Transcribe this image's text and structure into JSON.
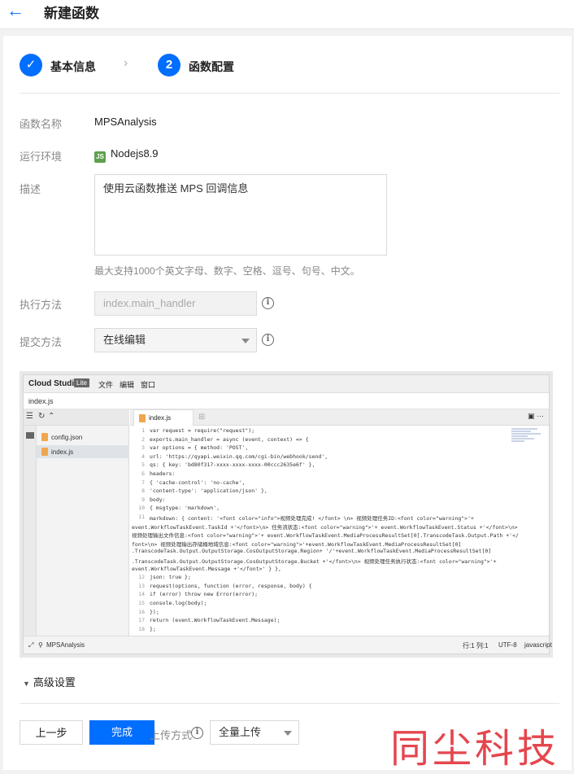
{
  "header": {
    "title": "新建函数"
  },
  "steps": [
    {
      "label": "基本信息",
      "marker": "✓"
    },
    {
      "label": "函数配置",
      "marker": "2"
    }
  ],
  "form": {
    "name_label": "函数名称",
    "name_value": "MPSAnalysis",
    "runtime_label": "运行环境",
    "runtime_value": "Nodejs8.9",
    "runtime_icon": "nodejs-icon",
    "desc_label": "描述",
    "desc_value": "使用云函数推送 MPS 回调信息",
    "desc_hint": "最大支持1000个英文字母、数字、空格、逗号、句号、中文。",
    "handler_label": "执行方法",
    "handler_value": "index.main_handler",
    "submit_label": "提交方法",
    "submit_value": "在线编辑"
  },
  "ide": {
    "brand": "Cloud Studio",
    "badge": "Lite",
    "menus": [
      "文件",
      "编辑",
      "窗口"
    ],
    "path": "index.js",
    "files": [
      "config.json",
      "index.js"
    ],
    "tab": "index.js",
    "code_lines": [
      {
        "n": "1",
        "t": "var request = require(\"request\");"
      },
      {
        "n": "2",
        "t": "exports.main_handler = async (event, context) => {"
      },
      {
        "n": "3",
        "t": "        var options = { method: 'POST',"
      },
      {
        "n": "4",
        "t": "        url: 'https://qyapi.weixin.qq.com/cgi-bin/webhook/send',"
      },
      {
        "n": "5",
        "t": "        qs: { key: 'bd80f317-xxxx-xxxx-xxxx-00ccc2635e6f' },"
      },
      {
        "n": "6",
        "t": "        headers:"
      },
      {
        "n": "7",
        "t": "        { 'cache-control': 'no-cache',"
      },
      {
        "n": "8",
        "t": "          'content-type': 'application/json' },"
      },
      {
        "n": "9",
        "t": "        body:"
      },
      {
        "n": "10",
        "t": "        { msgtype: 'markdown',"
      },
      {
        "n": "11",
        "t": "          markdown: { content: '<font color=\"info\">视频处理完成! </font> \\n> 视频处理任务ID:<font color=\"warning\">'+"
      },
      {
        "n": "",
        "t": "event.WorkflowTaskEvent.TaskId +'</font>\\n> 任务流状态:<font color=\"warning\">'+ event.WorkflowTaskEvent.Status +'</font>\\n>"
      },
      {
        "n": "",
        "t": "视频处理输出文件信息:<font color=\"warning\">'+ event.WorkflowTaskEvent.MediaProcessResultSet[0].TranscodeTask.Output.Path +'</"
      },
      {
        "n": "",
        "t": "font>\\n> 视频处理输出存储桶地域信息:<font color=\"warning\">'+event.WorkflowTaskEvent.MediaProcessResultSet[0]"
      },
      {
        "n": "",
        "t": ".TranscodeTask.Output.OutputStorage.CosOutputStorage.Region+ '/'+event.WorkflowTaskEvent.MediaProcessResultSet[0]"
      },
      {
        "n": "",
        "t": ".TranscodeTask.Output.OutputStorage.CosOutputStorage.Bucket +'</font>\\n> 视频处理任务执行状态:<font color=\"warning\">'+"
      },
      {
        "n": "",
        "t": "event.WorkflowTaskEvent.Message +'</font>' } },"
      },
      {
        "n": "12",
        "t": "        json: true };"
      },
      {
        "n": "13",
        "t": "        request(options, function (error, response, body) {"
      },
      {
        "n": "14",
        "t": "        if (error) throw new Error(error);"
      },
      {
        "n": "15",
        "t": "        console.log(body);"
      },
      {
        "n": "16",
        "t": "        });"
      },
      {
        "n": "17",
        "t": "return (event.WorkflowTaskEvent.Message);"
      },
      {
        "n": "18",
        "t": "};"
      }
    ],
    "status_left": "MPSAnalysis",
    "status_pos": "行:1 列:1",
    "status_enc": "UTF-8",
    "status_lang": "javascript"
  },
  "advanced": "高级设置",
  "footer": {
    "prev_label": "上一步",
    "done_label": "完成",
    "upload_label": "上传方式",
    "upload_value": "全量上传"
  },
  "watermark": "同尘科技",
  "colors": {
    "primary": "#006eff",
    "watermark": "#e3323b"
  }
}
